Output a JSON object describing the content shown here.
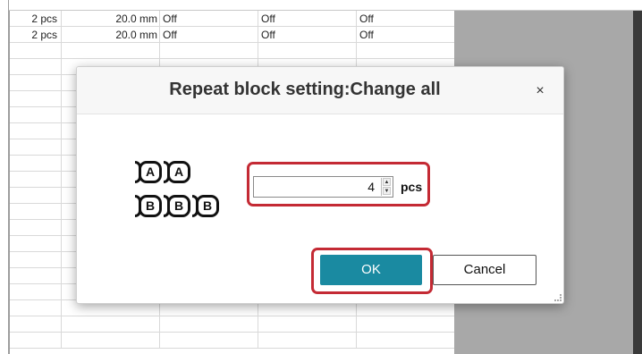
{
  "table": {
    "rows": [
      {
        "count": "2 pcs",
        "length": "20.0 mm",
        "col3": "Off",
        "col4": "Off",
        "col5": "Off"
      },
      {
        "count": "2 pcs",
        "length": "20.0 mm",
        "col3": "Off",
        "col4": "Off",
        "col5": "Off"
      }
    ]
  },
  "dialog": {
    "title": "Repeat block setting:Change all",
    "close_glyph": "×",
    "illustration": {
      "row_a": [
        "A",
        "A"
      ],
      "row_b": [
        "B",
        "B",
        "B"
      ]
    },
    "quantity": {
      "value": "4",
      "unit": "pcs"
    },
    "spinner": {
      "up": "▲",
      "down": "▼"
    },
    "ok_label": "OK",
    "cancel_label": "Cancel"
  },
  "colors": {
    "accent": "#1a8aa1",
    "highlight": "#c42a34",
    "overlay": "#a8a8a8"
  }
}
